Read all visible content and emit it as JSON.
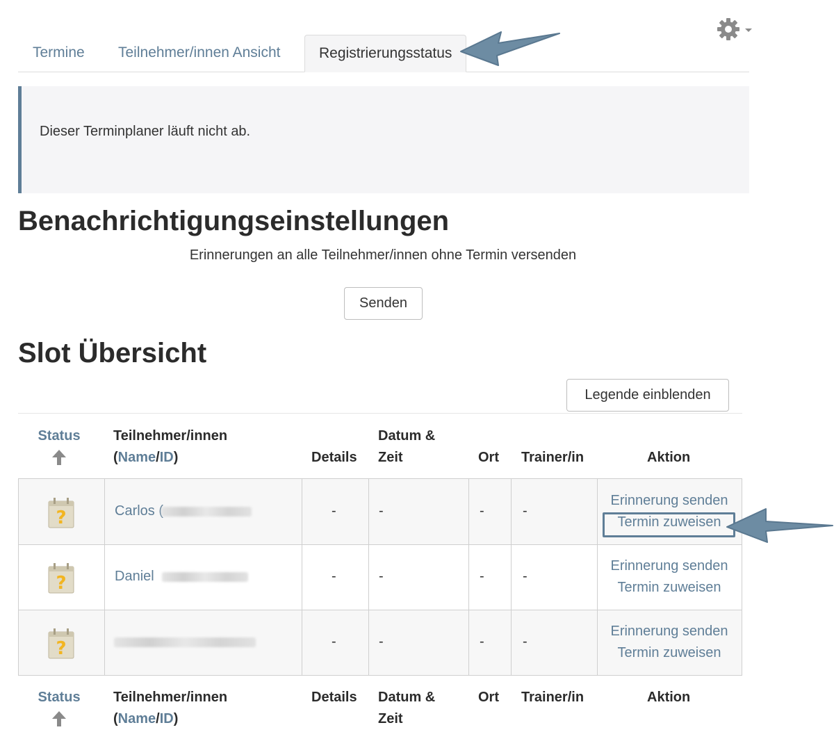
{
  "tabs": [
    {
      "label": "Termine"
    },
    {
      "label": "Teilnehmer/innen Ansicht"
    },
    {
      "label": "Registrierungsstatus"
    }
  ],
  "notice": "Dieser Terminplaner läuft nicht ab.",
  "notify_section": {
    "heading": "Benachrichtigungseinstellungen",
    "text": "Erinnerungen an alle Teilnehmer/innen ohne Termin versenden",
    "send_button": "Senden"
  },
  "slot_section": {
    "heading": "Slot Übersicht",
    "legend_button": "Legende einblenden"
  },
  "table": {
    "headers": {
      "status": "Status",
      "participants": "Teilnehmer/innen",
      "name_id_open": "(",
      "name": "Name",
      "slash": "/",
      "id": "ID",
      "name_id_close": ")",
      "details": "Details",
      "datetime_line1": "Datum &",
      "datetime_line2": "Zeit",
      "location": "Ort",
      "trainer": "Trainer/in",
      "action": "Aktion"
    },
    "rows": [
      {
        "name": "Carlos (",
        "details": "-",
        "datetime": "-",
        "location": "-",
        "trainer": "-",
        "remind": "Erinnerung senden",
        "assign": "Termin zuweisen"
      },
      {
        "name": "Daniel",
        "details": "-",
        "datetime": "-",
        "location": "-",
        "trainer": "-",
        "remind": "Erinnerung senden",
        "assign": "Termin zuweisen"
      },
      {
        "name": "",
        "details": "-",
        "datetime": "-",
        "location": "-",
        "trainer": "-",
        "remind": "Erinnerung senden",
        "assign": "Termin zuweisen"
      }
    ]
  },
  "colors": {
    "link": "#5f7e97",
    "arrow": "#6d8ca3"
  },
  "icons": {
    "settings": "gear-icon",
    "sort": "arrow-up-icon",
    "status": "calendar-question-icon"
  }
}
